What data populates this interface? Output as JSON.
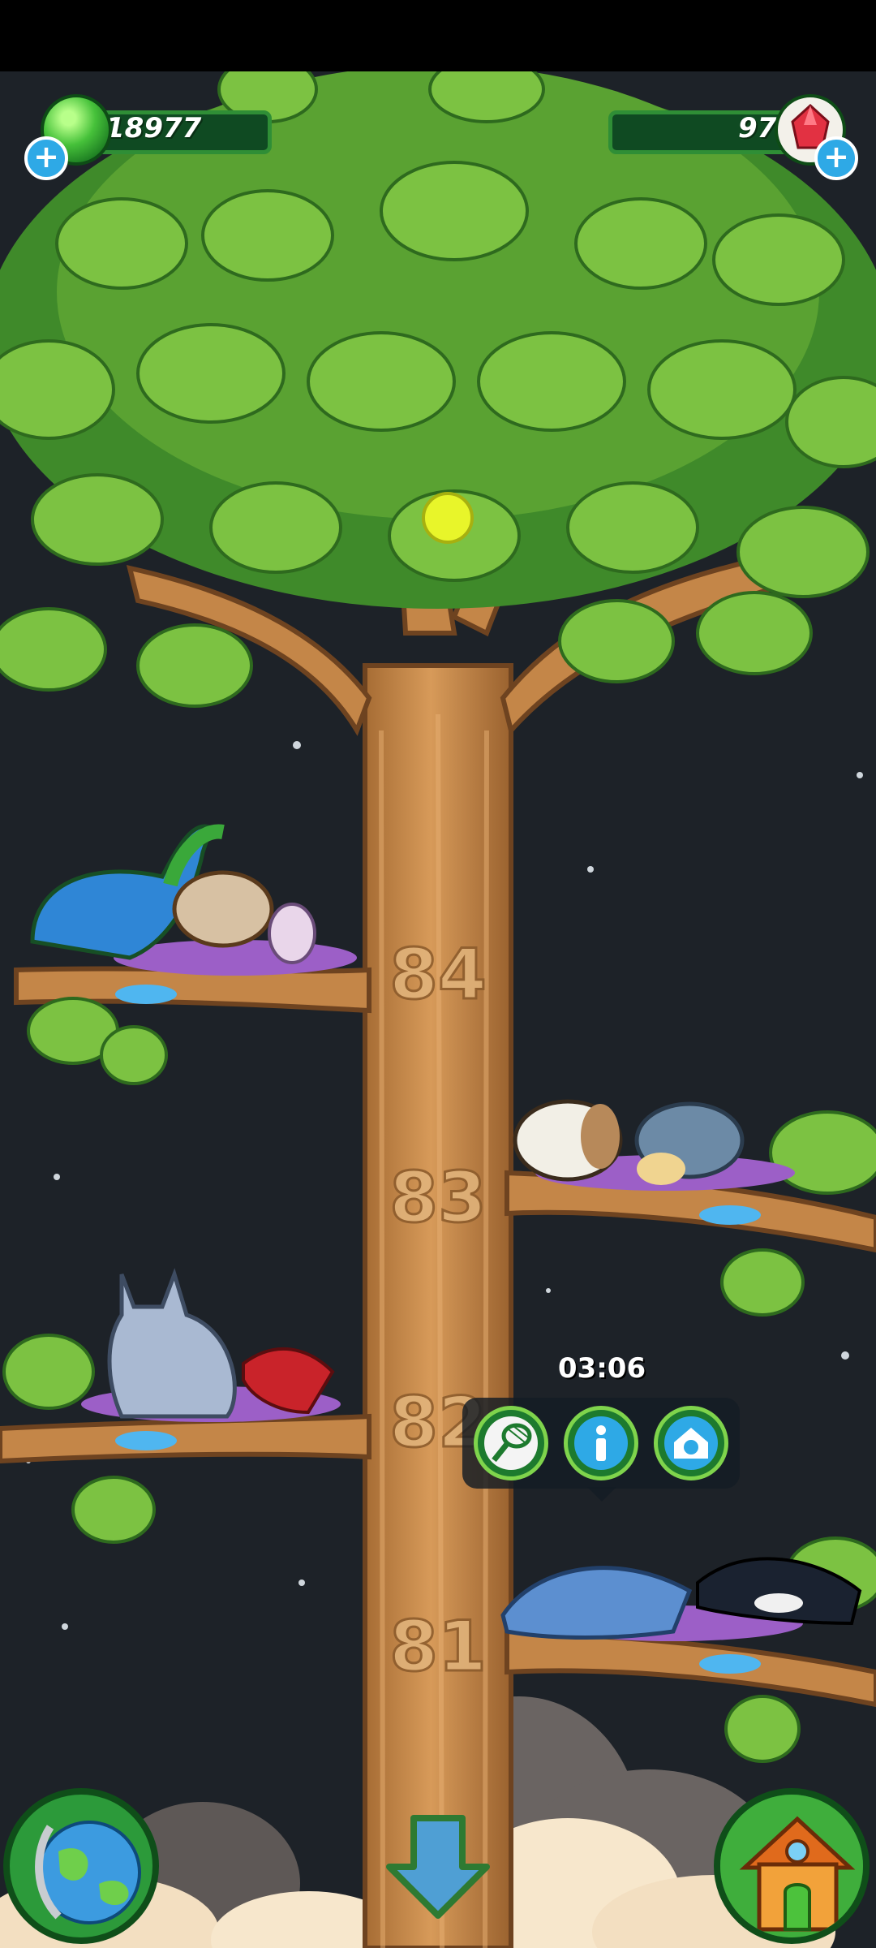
{
  "hud": {
    "left_currency": {
      "value": "18977",
      "icon": "green-egg-icon",
      "add_icon": "plus-icon"
    },
    "right_currency": {
      "value": "97",
      "icon": "red-gem-icon",
      "add_icon": "plus-icon"
    }
  },
  "branches": [
    {
      "number": "84",
      "animals": [
        "dinosaur",
        "lionfish",
        "egg"
      ]
    },
    {
      "number": "83",
      "animals": [
        "rabbit",
        "hedgehog"
      ]
    },
    {
      "number": "82",
      "animals": [
        "lynx",
        "lobster"
      ]
    },
    {
      "number": "81",
      "animals": [
        "dolphin",
        "orca"
      ]
    }
  ],
  "popup": {
    "timer": "03:06",
    "buttons": [
      "net-icon",
      "info-icon",
      "home-pet-icon"
    ]
  },
  "bottom_nav": {
    "left": "globe-icon",
    "center": "down-arrow-icon",
    "right": "house-icon"
  },
  "colors": {
    "sky": "#1d2228",
    "trunk": "#c98a4b",
    "leaf": "#7cc242",
    "leaf_dark": "#3f8a2a",
    "hud_green": "#2f8e36",
    "plus_blue": "#2ea9e6"
  }
}
